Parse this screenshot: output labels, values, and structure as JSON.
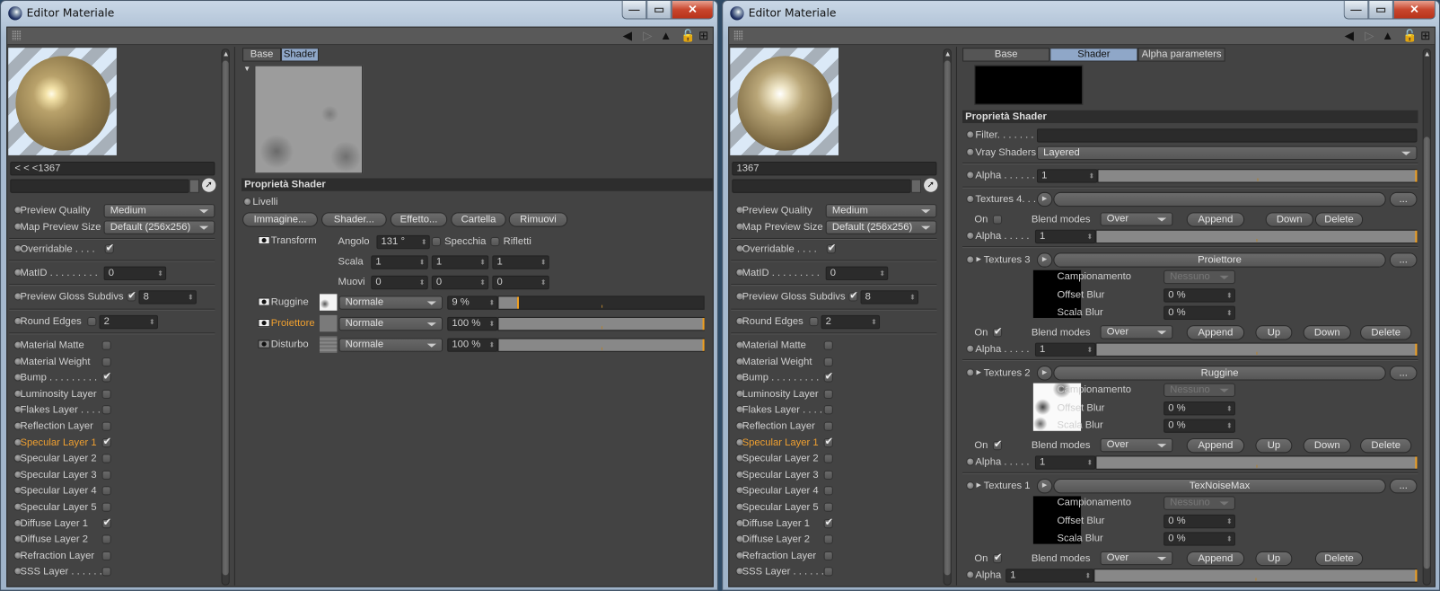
{
  "colors": {
    "accent_blue": "#8fa7c8",
    "highlight_orange": "#f0a030",
    "panel_bg": "#434343"
  },
  "windows": [
    {
      "title": "Editor Materiale",
      "window_buttons": {
        "minimize": "—",
        "maximize": "▭",
        "close": "✕"
      },
      "material_name": "< < <1367",
      "search": "",
      "left_panel": {
        "preview_quality_label": "Preview Quality",
        "preview_quality": "Medium",
        "map_preview_size_label": "Map Preview Size",
        "map_preview_size": "Default (256x256)",
        "overridable_label": "Overridable . . . .",
        "overridable": true,
        "matid_label": "MatID . . . . . . . . .",
        "matid": "0",
        "gloss_label": "Preview Gloss Subdivs",
        "gloss_enabled": true,
        "gloss": "8",
        "round_label": "Round Edges",
        "round_enabled": false,
        "round": "2",
        "layers": [
          {
            "label": "Material Matte",
            "checked": false
          },
          {
            "label": "Material Weight",
            "checked": false
          },
          {
            "label": "Bump . . . . . . . . .",
            "checked": true
          },
          {
            "label": "Luminosity Layer",
            "checked": false
          },
          {
            "label": "Flakes Layer . . . .",
            "checked": false
          },
          {
            "label": "Reflection Layer",
            "checked": false
          },
          {
            "label": "Specular Layer 1",
            "checked": true,
            "active": true
          },
          {
            "label": "Specular Layer 2",
            "checked": false
          },
          {
            "label": "Specular Layer 3",
            "checked": false
          },
          {
            "label": "Specular Layer 4",
            "checked": false
          },
          {
            "label": "Specular Layer 5",
            "checked": false
          },
          {
            "label": "Diffuse Layer 1",
            "checked": true
          },
          {
            "label": "Diffuse Layer 2",
            "checked": false
          },
          {
            "label": "Refraction Layer",
            "checked": false
          },
          {
            "label": "SSS Layer . . . . . .",
            "checked": false
          }
        ]
      },
      "shader": {
        "tabs": [
          "Base",
          "Shader"
        ],
        "active_tab": 1,
        "header": "Proprietà Shader",
        "livelli": "Livelli",
        "buttons": [
          "Immagine...",
          "Shader...",
          "Effetto...",
          "Cartella",
          "Rimuovi"
        ],
        "transform": {
          "label": "Transform",
          "angolo_label": "Angolo",
          "angolo": "131 °",
          "specchia": "Specchia",
          "specchia_checked": false,
          "rifletti": "Rifletti",
          "rifletti_checked": false,
          "scala_label": "Scala",
          "scala": [
            "1",
            "1",
            "1"
          ],
          "muovi_label": "Muovi",
          "muovi": [
            "0",
            "0",
            "0"
          ]
        },
        "layers": [
          {
            "name": "Ruggine",
            "mode": "Normale",
            "opacity": "9 %",
            "fraction": 0.09,
            "visible": true,
            "active": false
          },
          {
            "name": "Proiettore",
            "mode": "Normale",
            "opacity": "100 %",
            "fraction": 1.0,
            "visible": true,
            "active": true
          },
          {
            "name": "Disturbo",
            "mode": "Normale",
            "opacity": "100 %",
            "fraction": 1.0,
            "visible": false,
            "active": false
          }
        ]
      }
    },
    {
      "title": "Editor Materiale",
      "window_buttons": {
        "minimize": "—",
        "maximize": "▭",
        "close": "✕"
      },
      "material_name": "1367",
      "search": "",
      "left_panel": {
        "preview_quality_label": "Preview Quality",
        "preview_quality": "Medium",
        "map_preview_size_label": "Map Preview Size",
        "map_preview_size": "Default (256x256)",
        "overridable_label": "Overridable . . . .",
        "overridable": true,
        "matid_label": "MatID . . . . . . . . .",
        "matid": "0",
        "gloss_label": "Preview Gloss Subdivs",
        "gloss_enabled": true,
        "gloss": "8",
        "round_label": "Round Edges",
        "round_enabled": false,
        "round": "2",
        "layers": [
          {
            "label": "Material Matte",
            "checked": false
          },
          {
            "label": "Material Weight",
            "checked": false
          },
          {
            "label": "Bump . . . . . . . . .",
            "checked": true
          },
          {
            "label": "Luminosity Layer",
            "checked": false
          },
          {
            "label": "Flakes Layer . . . .",
            "checked": false
          },
          {
            "label": "Reflection Layer",
            "checked": false
          },
          {
            "label": "Specular Layer 1",
            "checked": true,
            "active": true
          },
          {
            "label": "Specular Layer 2",
            "checked": false
          },
          {
            "label": "Specular Layer 3",
            "checked": false
          },
          {
            "label": "Specular Layer 4",
            "checked": false
          },
          {
            "label": "Specular Layer 5",
            "checked": false
          },
          {
            "label": "Diffuse Layer 1",
            "checked": true
          },
          {
            "label": "Diffuse Layer 2",
            "checked": false
          },
          {
            "label": "Refraction Layer",
            "checked": false
          },
          {
            "label": "SSS Layer . . . . . .",
            "checked": false
          }
        ]
      },
      "vray": {
        "tabs": [
          "Base",
          "Shader",
          "Alpha parameters"
        ],
        "active_tab": 1,
        "header": "Proprietà Shader",
        "filter_label": "Filter. . . . . . .",
        "filter": "",
        "vray_label": "Vray Shaders",
        "vray_value": "Layered",
        "alpha_label": "Alpha . . . . . .",
        "alpha": "1",
        "more_label": "...",
        "textures": [
          {
            "label": "Textures 4. . .",
            "name": "",
            "expanded": false,
            "on_label": "On",
            "on": false,
            "blend_label": "Blend modes",
            "blend": "Over",
            "buttons": [
              "Append",
              "Down",
              "Delete"
            ],
            "alpha_label": "Alpha . . . . .",
            "alpha": "1"
          },
          {
            "label": "Textures 3",
            "name": "Proiettore",
            "expanded": true,
            "thumb": "black",
            "campionamento_label": "Campionamento",
            "campionamento": "Nessuno",
            "offset_label": "Offset Blur",
            "offset": "0 %",
            "scala_label": "Scala Blur",
            "scala": "0 %",
            "on_label": "On",
            "on": true,
            "blend_label": "Blend modes",
            "blend": "Over",
            "buttons": [
              "Append",
              "Up",
              "Down",
              "Delete"
            ],
            "alpha_label": "Alpha . . . . .",
            "alpha": "1"
          },
          {
            "label": "Textures 2",
            "name": "Ruggine",
            "expanded": true,
            "thumb": "noise",
            "campionamento_label": "Campionamento",
            "campionamento": "Nessuno",
            "offset_label": "Offset Blur",
            "offset": "0 %",
            "scala_label": "Scala Blur",
            "scala": "0 %",
            "on_label": "On",
            "on": true,
            "blend_label": "Blend modes",
            "blend": "Over",
            "buttons": [
              "Append",
              "Up",
              "Down",
              "Delete"
            ],
            "alpha_label": "Alpha . . . . .",
            "alpha": "1"
          },
          {
            "label": "Textures 1",
            "name": "TexNoiseMax",
            "expanded": true,
            "thumb": "black",
            "campionamento_label": "Campionamento",
            "campionamento": "Nessuno",
            "offset_label": "Offset Blur",
            "offset": "0 %",
            "scala_label": "Scala Blur",
            "scala": "0 %",
            "on_label": "On",
            "on": true,
            "blend_label": "Blend modes",
            "blend": "Over",
            "buttons": [
              "Append",
              "Up",
              "Delete"
            ],
            "alpha_label": "Alpha",
            "alpha": "1"
          }
        ]
      }
    }
  ]
}
